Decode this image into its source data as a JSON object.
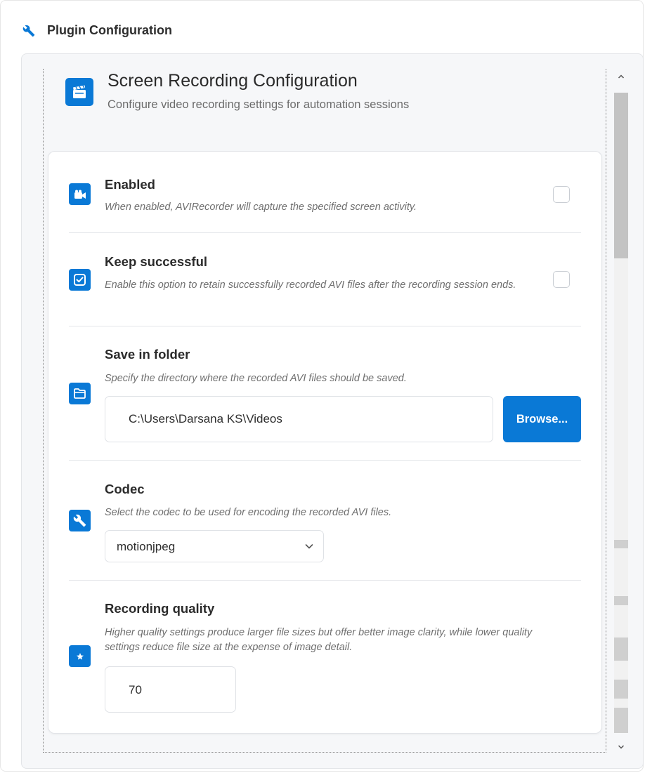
{
  "plugin": {
    "title": "Plugin Configuration"
  },
  "section": {
    "title": "Screen Recording Configuration",
    "subtitle": "Configure video recording settings for automation sessions"
  },
  "settings": {
    "enabled": {
      "label": "Enabled",
      "description": "When enabled, AVIRecorder will capture the specified screen activity.",
      "checked": false
    },
    "keep_successful": {
      "label": "Keep successful",
      "description": "Enable this option to retain successfully recorded AVI files after the recording session ends.",
      "checked": false
    },
    "save_folder": {
      "label": "Save in folder",
      "description": "Specify the directory where the recorded AVI files should be saved.",
      "value": "C:\\Users\\Darsana KS\\Videos",
      "browse_label": "Browse..."
    },
    "codec": {
      "label": "Codec",
      "description": "Select the codec to be used for encoding the recorded AVI files.",
      "selected": "motionjpeg"
    },
    "quality": {
      "label": "Recording quality",
      "description": "Higher quality settings produce larger file sizes but offer better image clarity, while lower quality settings reduce file size at the expense of image detail.",
      "value": "70"
    }
  },
  "colors": {
    "accent": "#0a79d6"
  }
}
